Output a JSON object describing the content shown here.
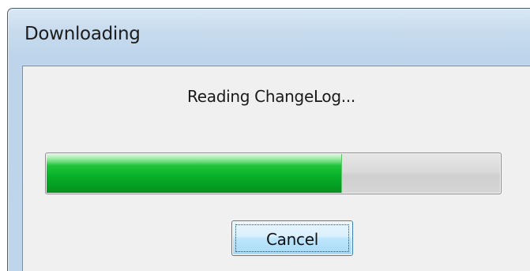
{
  "dialog": {
    "title": "Downloading",
    "status": "Reading ChangeLog...",
    "progress_fraction": 0.65,
    "cancel_label": "Cancel"
  },
  "colors": {
    "progress_fill": "#09b22a",
    "titlebar": "#c7dbee",
    "button_border": "#3c7fb1"
  }
}
